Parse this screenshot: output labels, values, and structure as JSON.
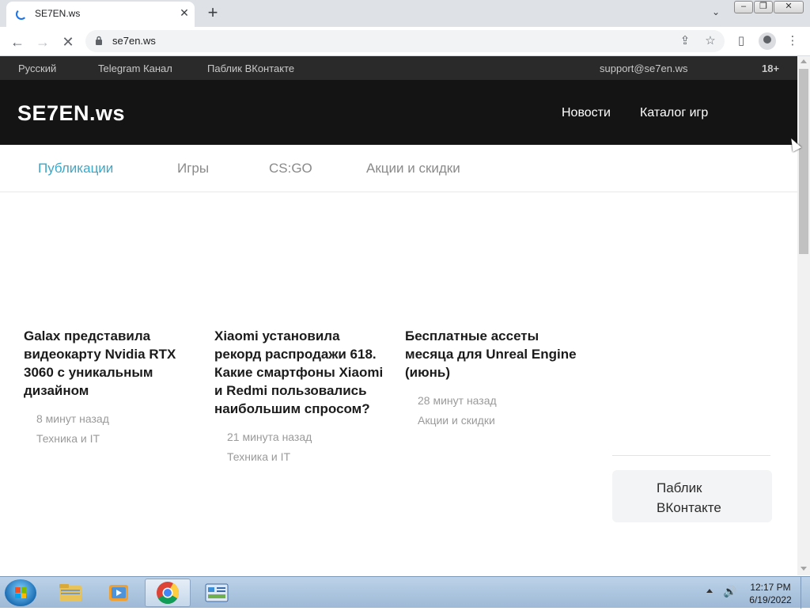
{
  "browser": {
    "tab_title": "SE7EN.ws",
    "url": "se7en.ws"
  },
  "site": {
    "topbar": {
      "language": "Русский",
      "telegram": "Telegram Канал",
      "vk": "Паблик ВКонтакте",
      "email": "support@se7en.ws",
      "age": "18+"
    },
    "logo": "SE7EN.ws",
    "nav": {
      "news": "Новости",
      "catalog": "Каталог игр"
    },
    "categories": [
      {
        "label": "Публикации",
        "active": true
      },
      {
        "label": "Игры",
        "active": false
      },
      {
        "label": "CS:GO",
        "active": false
      },
      {
        "label": "Акции и скидки",
        "active": false
      }
    ],
    "articles": [
      {
        "title": "Galax представила видеокарту Nvidia RTX 3060 с уникальным дизайном",
        "time": "8 минут назад",
        "category": "Техника и IT"
      },
      {
        "title": "Xiaomi установила рекорд распродажи 618. Какие смартфоны Xiaomi и Redmi пользовались наибольшим спросом?",
        "time": "21 минута назад",
        "category": "Техника и IT"
      },
      {
        "title": "Бесплатные ассеты месяца для Unreal Engine (июнь)",
        "time": "28 минут назад",
        "category": "Акции и скидки"
      }
    ],
    "sidebar": {
      "vk_label": "Паблик ВКонтакте"
    },
    "accent_color": "#3aa8c9"
  },
  "taskbar": {
    "time": "12:17 PM",
    "date": "6/19/2022"
  }
}
